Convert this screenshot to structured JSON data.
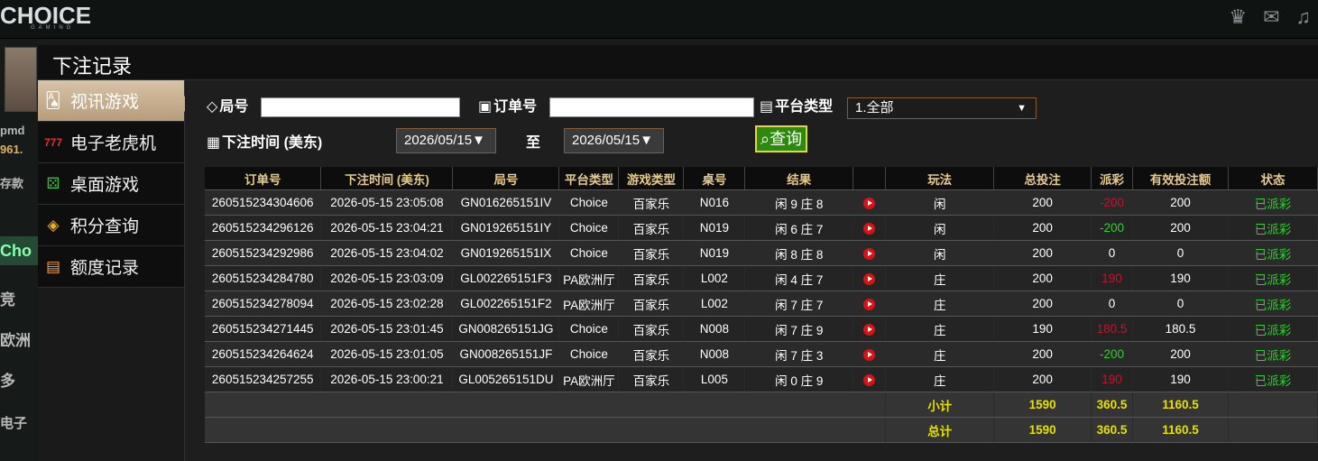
{
  "brand": {
    "logo": "CHOICE",
    "logo_sub": "GAMING"
  },
  "top_icons": [
    "vip-icon",
    "chat-icon",
    "music-icon"
  ],
  "left_strip": {
    "t1": "pmd",
    "t2": "961.",
    "t3": "存款",
    "t4": "Cho",
    "t5": "竞",
    "t6": "欧洲",
    "t7": "多",
    "t8": "电子"
  },
  "modal": {
    "title": "下注记录"
  },
  "sidebar": {
    "items": [
      {
        "label": "视讯游戏",
        "icon": "cards-icon"
      },
      {
        "label": "电子老虎机",
        "icon": "slot-777-icon"
      },
      {
        "label": "桌面游戏",
        "icon": "dice-icon"
      },
      {
        "label": "积分查询",
        "icon": "gem-icon"
      },
      {
        "label": "额度记录",
        "icon": "document-icon"
      }
    ]
  },
  "filters": {
    "round_label": "局号",
    "round_value": "",
    "order_label": "订单号",
    "order_value": "",
    "platform_label": "平台类型",
    "platform_value": "1.全部",
    "time_label": "下注时间 (美东)",
    "date_from": "2026/05/15▼",
    "to_label": "至",
    "date_to": "2026/05/15▼",
    "query_label": "查询"
  },
  "table": {
    "headers": [
      "订单号",
      "下注时间 (美东)",
      "局号",
      "平台类型",
      "游戏类型",
      "桌号",
      "结果",
      "",
      "玩法",
      "总投注",
      "派彩",
      "有效投注额",
      "状态"
    ],
    "rows": [
      {
        "order": "260515234304606",
        "time": "2026-05-15 23:05:08",
        "round": "GN016265151IV",
        "platform": "Choice",
        "game": "百家乐",
        "table": "N016",
        "result": "闲 9 庄 8",
        "play": "闲",
        "bet": "200",
        "payout": "-200",
        "payout_color": "red",
        "valid": "200",
        "status": "已派彩"
      },
      {
        "order": "260515234296126",
        "time": "2026-05-15 23:04:21",
        "round": "GN019265151IY",
        "platform": "Choice",
        "game": "百家乐",
        "table": "N019",
        "result": "闲 6 庄 7",
        "play": "闲",
        "bet": "200",
        "payout": "-200",
        "payout_color": "green",
        "valid": "200",
        "status": "已派彩"
      },
      {
        "order": "260515234292986",
        "time": "2026-05-15 23:04:02",
        "round": "GN019265151IX",
        "platform": "Choice",
        "game": "百家乐",
        "table": "N019",
        "result": "闲 8 庄 8",
        "play": "闲",
        "bet": "200",
        "payout": "0",
        "payout_color": "white",
        "valid": "0",
        "status": "已派彩"
      },
      {
        "order": "260515234284780",
        "time": "2026-05-15 23:03:09",
        "round": "GL002265151F3",
        "platform": "PA欧洲厅",
        "game": "百家乐",
        "table": "L002",
        "result": "闲 4 庄 7",
        "play": "庄",
        "bet": "200",
        "payout": "190",
        "payout_color": "red",
        "valid": "190",
        "status": "已派彩"
      },
      {
        "order": "260515234278094",
        "time": "2026-05-15 23:02:28",
        "round": "GL002265151F2",
        "platform": "PA欧洲厅",
        "game": "百家乐",
        "table": "L002",
        "result": "闲 7 庄 7",
        "play": "庄",
        "bet": "200",
        "payout": "0",
        "payout_color": "white",
        "valid": "0",
        "status": "已派彩"
      },
      {
        "order": "260515234271445",
        "time": "2026-05-15 23:01:45",
        "round": "GN008265151JG",
        "platform": "Choice",
        "game": "百家乐",
        "table": "N008",
        "result": "闲 7 庄 9",
        "play": "庄",
        "bet": "190",
        "payout": "180.5",
        "payout_color": "red",
        "valid": "180.5",
        "status": "已派彩"
      },
      {
        "order": "260515234264624",
        "time": "2026-05-15 23:01:05",
        "round": "GN008265151JF",
        "platform": "Choice",
        "game": "百家乐",
        "table": "N008",
        "result": "闲 7 庄 3",
        "play": "庄",
        "bet": "200",
        "payout": "-200",
        "payout_color": "green",
        "valid": "200",
        "status": "已派彩"
      },
      {
        "order": "260515234257255",
        "time": "2026-05-15 23:00:21",
        "round": "GL005265151DU",
        "platform": "PA欧洲厅",
        "game": "百家乐",
        "table": "L005",
        "result": "闲 0 庄 9",
        "play": "庄",
        "bet": "200",
        "payout": "190",
        "payout_color": "red",
        "valid": "190",
        "status": "已派彩"
      }
    ],
    "subtotal": {
      "label": "小计",
      "bet": "1590",
      "payout": "360.5",
      "valid": "1160.5"
    },
    "total": {
      "label": "总计",
      "bet": "1590",
      "payout": "360.5",
      "valid": "1160.5"
    }
  },
  "colors": {
    "accent": "#e6c98e",
    "status_green": "#2fd12f",
    "loss_red": "#c8102e",
    "total_yellow": "#e7e000"
  }
}
